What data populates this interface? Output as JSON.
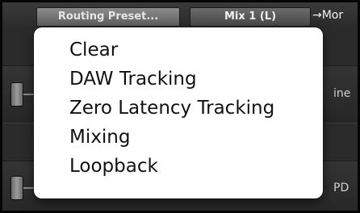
{
  "toolbar": {
    "routing_preset_label": "Routing Preset...",
    "mix_label": "Mix 1 (L)",
    "arrow_more_label": "→Mor"
  },
  "background": {
    "row2_side_label": "ine",
    "row3_side_label": "PD"
  },
  "routing_preset_menu": {
    "items": [
      {
        "label": "Clear"
      },
      {
        "label": "DAW Tracking"
      },
      {
        "label": "Zero Latency Tracking"
      },
      {
        "label": "Mixing"
      },
      {
        "label": "Loopback"
      }
    ]
  },
  "colors": {
    "menu_background": "#ffffff",
    "menu_text": "#111111",
    "panel_background": "#2b2b2b"
  }
}
